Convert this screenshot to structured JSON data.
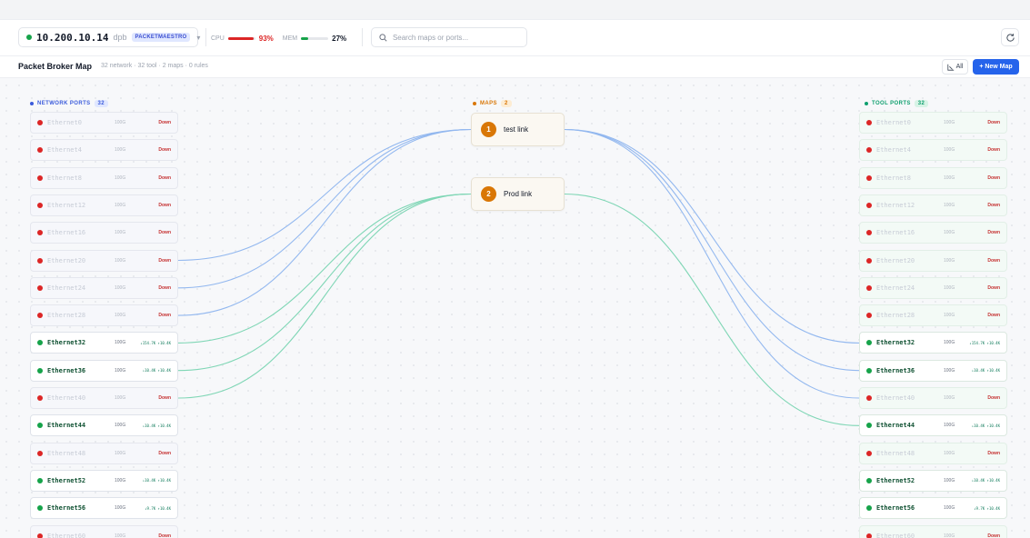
{
  "toolbar": {
    "host_ip": "10.200.10.14",
    "host_proto": "dpb",
    "host_badge": "PACKETMAESTRO",
    "cpu_label": "CPU",
    "cpu_value": "93%",
    "cpu_fraction": 0.93,
    "mem_label": "MEM",
    "mem_value": "27%",
    "mem_fraction": 0.27,
    "search_placeholder": "Search maps or ports..."
  },
  "subheader": {
    "title": "Packet Broker Map",
    "stats": "32 network · 32 tool · 2 maps · 0 rules",
    "all_label": "All",
    "new_map_label": "+ New Map"
  },
  "columns": {
    "network": {
      "title": "NETWORK PORTS",
      "count": "32"
    },
    "maps": {
      "title": "MAPS",
      "count": "2"
    },
    "tool": {
      "title": "TOOL PORTS",
      "count": "32"
    }
  },
  "maps": [
    {
      "num": "1",
      "name": "test link"
    },
    {
      "num": "2",
      "name": "Prod link"
    }
  ],
  "network_ports": [
    {
      "name": "Ethernet0",
      "speed": "100G",
      "up": false,
      "status": "Down"
    },
    {
      "name": "Ethernet4",
      "speed": "100G",
      "up": false,
      "status": "Down"
    },
    {
      "name": "Ethernet8",
      "speed": "100G",
      "up": false,
      "status": "Down"
    },
    {
      "name": "Ethernet12",
      "speed": "100G",
      "up": false,
      "status": "Down"
    },
    {
      "name": "Ethernet16",
      "speed": "100G",
      "up": false,
      "status": "Down"
    },
    {
      "name": "Ethernet20",
      "speed": "100G",
      "up": false,
      "status": "Down"
    },
    {
      "name": "Ethernet24",
      "speed": "100G",
      "up": false,
      "status": "Down"
    },
    {
      "name": "Ethernet28",
      "speed": "100G",
      "up": false,
      "status": "Down"
    },
    {
      "name": "Ethernet32",
      "speed": "100G",
      "up": true,
      "status": "↓154.7K ↑10.4K"
    },
    {
      "name": "Ethernet36",
      "speed": "100G",
      "up": true,
      "status": "↓10.4K ↑10.4K"
    },
    {
      "name": "Ethernet40",
      "speed": "100G",
      "up": false,
      "status": "Down"
    },
    {
      "name": "Ethernet44",
      "speed": "100G",
      "up": true,
      "status": "↓10.4K ↑10.4K"
    },
    {
      "name": "Ethernet48",
      "speed": "100G",
      "up": false,
      "status": "Down"
    },
    {
      "name": "Ethernet52",
      "speed": "100G",
      "up": true,
      "status": "↓10.4K ↑10.4K"
    },
    {
      "name": "Ethernet56",
      "speed": "100G",
      "up": true,
      "status": "↓9.7K ↑10.4K"
    },
    {
      "name": "Ethernet60",
      "speed": "100G",
      "up": false,
      "status": "Down"
    }
  ],
  "tool_ports": [
    {
      "name": "Ethernet0",
      "speed": "100G",
      "up": false,
      "status": "Down"
    },
    {
      "name": "Ethernet4",
      "speed": "100G",
      "up": false,
      "status": "Down"
    },
    {
      "name": "Ethernet8",
      "speed": "100G",
      "up": false,
      "status": "Down"
    },
    {
      "name": "Ethernet12",
      "speed": "100G",
      "up": false,
      "status": "Down"
    },
    {
      "name": "Ethernet16",
      "speed": "100G",
      "up": false,
      "status": "Down"
    },
    {
      "name": "Ethernet20",
      "speed": "100G",
      "up": false,
      "status": "Down"
    },
    {
      "name": "Ethernet24",
      "speed": "100G",
      "up": false,
      "status": "Down"
    },
    {
      "name": "Ethernet28",
      "speed": "100G",
      "up": false,
      "status": "Down"
    },
    {
      "name": "Ethernet32",
      "speed": "100G",
      "up": true,
      "status": "↓154.7K ↑10.4K"
    },
    {
      "name": "Ethernet36",
      "speed": "100G",
      "up": true,
      "status": "↓10.4K ↑10.4K"
    },
    {
      "name": "Ethernet40",
      "speed": "100G",
      "up": false,
      "status": "Down"
    },
    {
      "name": "Ethernet44",
      "speed": "100G",
      "up": true,
      "status": "↓10.4K ↑10.4K"
    },
    {
      "name": "Ethernet48",
      "speed": "100G",
      "up": false,
      "status": "Down"
    },
    {
      "name": "Ethernet52",
      "speed": "100G",
      "up": true,
      "status": "↓10.4K ↑10.4K"
    },
    {
      "name": "Ethernet56",
      "speed": "100G",
      "up": true,
      "status": "↓9.7K ↑10.4K"
    },
    {
      "name": "Ethernet60",
      "speed": "100G",
      "up": false,
      "status": "Down"
    }
  ],
  "links": [
    {
      "map": 0,
      "network": [
        5,
        6,
        7
      ],
      "tool": [
        8,
        9,
        10
      ]
    },
    {
      "map": 1,
      "network": [
        8,
        9,
        10
      ],
      "tool": [
        11
      ]
    }
  ],
  "colors": {
    "accent": "#2563eb",
    "map_badge": "#d97706",
    "up": "#16a34a",
    "down": "#dc2626",
    "link_map1": "#93b8ef",
    "link_map2": "#7fd6b5",
    "network_head": "#3b5bdb",
    "maps_head": "#d97706",
    "tool_head": "#0e9f6e"
  }
}
